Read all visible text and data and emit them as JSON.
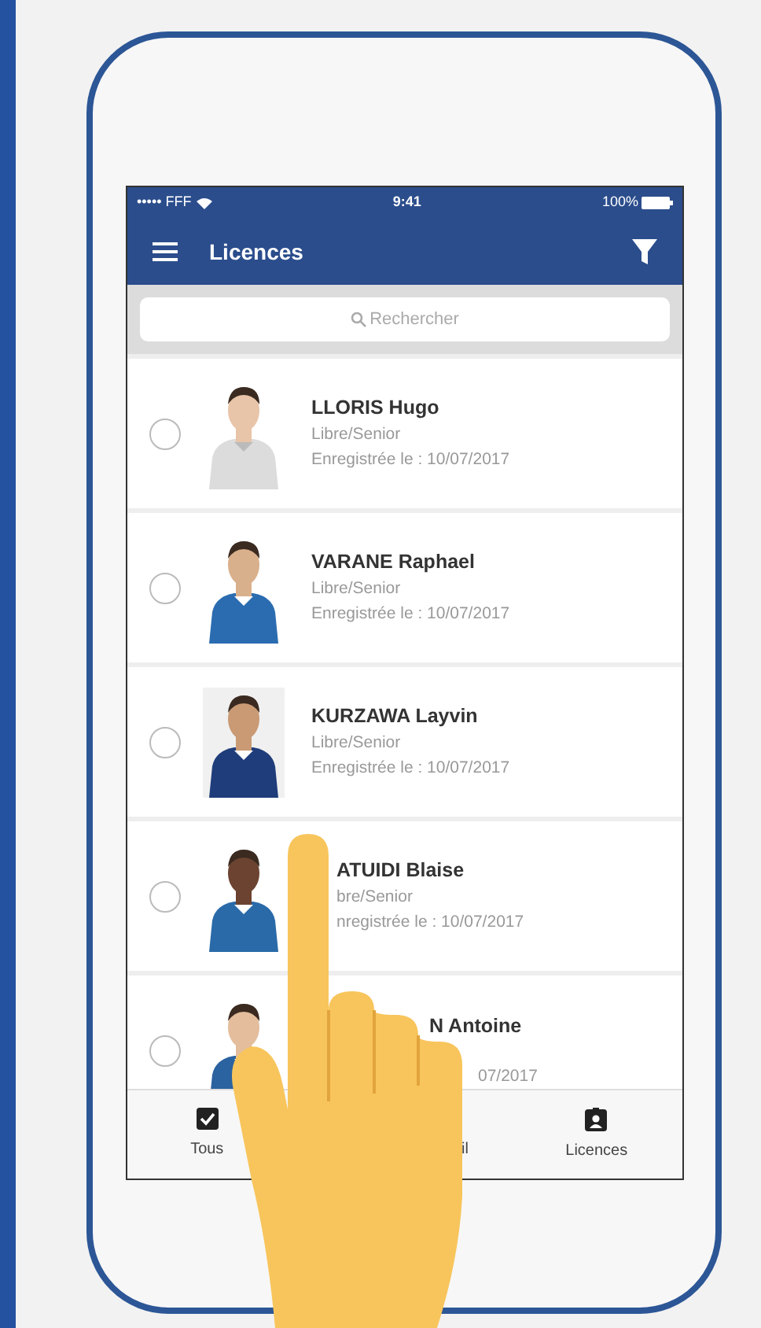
{
  "status_bar": {
    "carrier": "••••• FFF",
    "time": "9:41",
    "battery": "100%"
  },
  "header": {
    "title": "Licences"
  },
  "search": {
    "placeholder": "Rechercher"
  },
  "licences": [
    {
      "name": "LLORIS Hugo",
      "category": "Libre/Senior",
      "registered": "Enregistrée le : 10/07/2017",
      "selected": false
    },
    {
      "name": "VARANE Raphael",
      "category": "Libre/Senior",
      "registered": "Enregistrée le : 10/07/2017",
      "selected": false
    },
    {
      "name": "KURZAWA Layvin",
      "category": "Libre/Senior",
      "registered": "Enregistrée le : 10/07/2017",
      "selected": false
    },
    {
      "name": "ATUIDI Blaise",
      "category": "bre/Senior",
      "registered": "nregistrée le : 10/07/2017",
      "selected": false
    },
    {
      "name": "N Antoine",
      "registered": "07/2017",
      "selected": false
    }
  ],
  "tab_bar": [
    {
      "label": "Tous",
      "kind": "check"
    },
    {
      "label": "il",
      "kind": "covered"
    },
    {
      "label": "Licences",
      "kind": "badge"
    }
  ]
}
